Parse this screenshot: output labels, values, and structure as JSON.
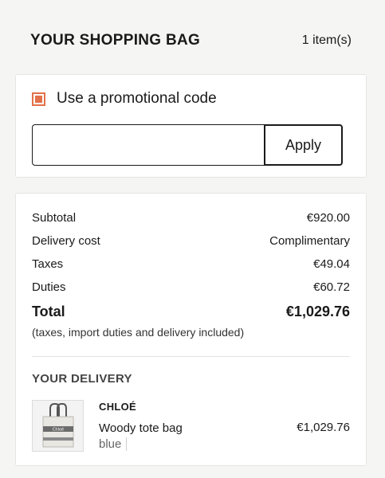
{
  "header": {
    "title": "YOUR SHOPPING BAG",
    "item_count": "1 item(s)"
  },
  "promo": {
    "label": "Use a promotional code",
    "checked": true,
    "input_value": "",
    "apply_label": "Apply",
    "accent_color": "#e3714a"
  },
  "summary": {
    "rows": [
      {
        "label": "Subtotal",
        "value": "€920.00"
      },
      {
        "label": "Delivery cost",
        "value": "Complimentary"
      },
      {
        "label": "Taxes",
        "value": "€49.04"
      },
      {
        "label": "Duties",
        "value": "€60.72"
      }
    ],
    "total_label": "Total",
    "total_value": "€1,029.76",
    "total_note": "(taxes, import duties and delivery included)"
  },
  "delivery": {
    "heading": "YOUR DELIVERY",
    "items": [
      {
        "brand": "CHLOÉ",
        "name": "Woody tote bag",
        "color": "blue",
        "price": "€1,029.76",
        "image_icon": "tote-bag-icon"
      }
    ]
  }
}
